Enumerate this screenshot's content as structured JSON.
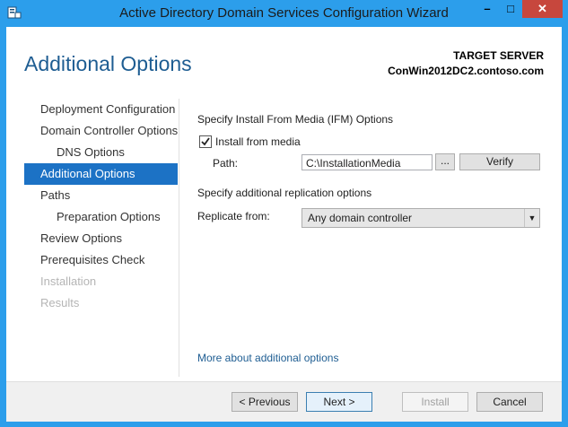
{
  "window": {
    "title": "Active Directory Domain Services Configuration Wizard",
    "minimize_glyph": "–",
    "maximize_glyph": "□",
    "close_glyph": "✕"
  },
  "header": {
    "page_title": "Additional Options",
    "target_server_label": "TARGET SERVER",
    "target_server_name": "ConWin2012DC2.contoso.com"
  },
  "nav": {
    "items": [
      {
        "label": "Deployment Configuration"
      },
      {
        "label": "Domain Controller Options"
      },
      {
        "label": "DNS Options"
      },
      {
        "label": "Additional Options"
      },
      {
        "label": "Paths"
      },
      {
        "label": "Preparation Options"
      },
      {
        "label": "Review Options"
      },
      {
        "label": "Prerequisites Check"
      },
      {
        "label": "Installation"
      },
      {
        "label": "Results"
      }
    ]
  },
  "main": {
    "ifm_heading": "Specify Install From Media (IFM) Options",
    "install_from_media_label": "Install from media",
    "install_from_media_checked": true,
    "path_label": "Path:",
    "path_value": "C:\\InstallationMedia",
    "browse_label": "...",
    "verify_label": "Verify",
    "replication_heading": "Specify additional replication options",
    "replicate_from_label": "Replicate from:",
    "replicate_from_value": "Any domain controller",
    "more_link": "More about additional options"
  },
  "footer": {
    "previous_label": "< Previous",
    "next_label": "Next >",
    "install_label": "Install",
    "cancel_label": "Cancel"
  },
  "colors": {
    "accent": "#2c9eeb",
    "active_nav": "#1c72c5",
    "close_button": "#c7473d",
    "page_title": "#1e5d92"
  }
}
